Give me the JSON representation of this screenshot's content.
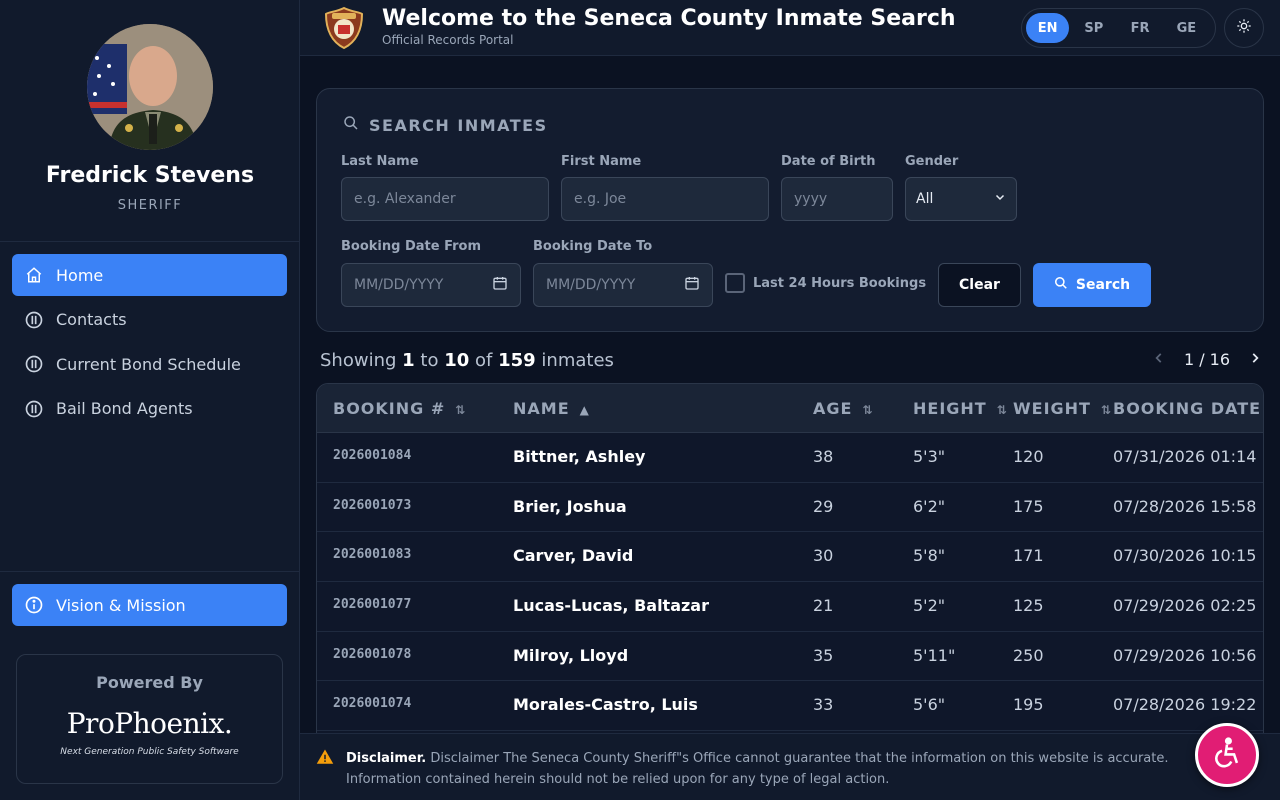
{
  "profile": {
    "name": "Fredrick Stevens",
    "role": "SHERIFF"
  },
  "nav": {
    "items": [
      {
        "label": "Home",
        "icon": "home-icon",
        "active": true
      },
      {
        "label": "Contacts",
        "icon": "info-icon"
      },
      {
        "label": "Current Bond Schedule",
        "icon": "info-icon"
      },
      {
        "label": "Bail Bond Agents",
        "icon": "info-icon"
      }
    ],
    "vision": "Vision & Mission"
  },
  "powered": {
    "label": "Powered By",
    "logo_text": "ProPhoenix.",
    "tagline": "Next Generation Public Safety Software"
  },
  "header": {
    "title": "Welcome to the Seneca County Inmate Search",
    "subtitle": "Official Records Portal",
    "languages": [
      "EN",
      "SP",
      "FR",
      "GE"
    ],
    "active_language": "EN"
  },
  "search": {
    "heading": "SEARCH INMATES",
    "last_name": {
      "label": "Last Name",
      "placeholder": "e.g. Alexander"
    },
    "first_name": {
      "label": "First Name",
      "placeholder": "e.g. Joe"
    },
    "dob": {
      "label": "Date of Birth",
      "placeholder": "yyyy"
    },
    "gender": {
      "label": "Gender",
      "value": "All"
    },
    "booking_from": {
      "label": "Booking Date From",
      "placeholder": "MM/DD/YYYY"
    },
    "booking_to": {
      "label": "Booking Date To",
      "placeholder": "MM/DD/YYYY"
    },
    "last24": "Last 24 Hours Bookings",
    "clear": "Clear",
    "search": "Search"
  },
  "results": {
    "showing": "Showing",
    "from": "1",
    "to_word": "to",
    "to": "10",
    "of_word": "of",
    "total": "159",
    "suffix": "inmates",
    "page": "1 / 16"
  },
  "table": {
    "headers": [
      "BOOKING #",
      "NAME",
      "AGE",
      "HEIGHT",
      "WEIGHT",
      "BOOKING DATE"
    ],
    "rows": [
      [
        "2026001084",
        "Bittner, Ashley",
        "38",
        "5'3\"",
        "120",
        "07/31/2026 01:14"
      ],
      [
        "2026001073",
        "Brier, Joshua",
        "29",
        "6'2\"",
        "175",
        "07/28/2026 15:58"
      ],
      [
        "2026001083",
        "Carver, David",
        "30",
        "5'8\"",
        "171",
        "07/30/2026 10:15"
      ],
      [
        "2026001077",
        "Lucas-Lucas, Baltazar",
        "21",
        "5'2\"",
        "125",
        "07/29/2026 02:25"
      ],
      [
        "2026001078",
        "Milroy, Lloyd",
        "35",
        "5'11\"",
        "250",
        "07/29/2026 10:56"
      ],
      [
        "2026001074",
        "Morales-Castro, Luis",
        "33",
        "5'6\"",
        "195",
        "07/28/2026 19:22"
      ]
    ]
  },
  "disclaimer": {
    "label": "Disclaimer.",
    "text": "Disclaimer The Seneca County Sheriff\"s Office cannot guarantee that the information on this website is accurate.  Information contained herein should not be relied upon for any type of legal action."
  },
  "colors": {
    "accent": "#3b82f6",
    "background": "#0b1222",
    "panel": "#131c2f",
    "a11y": "#e11d74"
  }
}
